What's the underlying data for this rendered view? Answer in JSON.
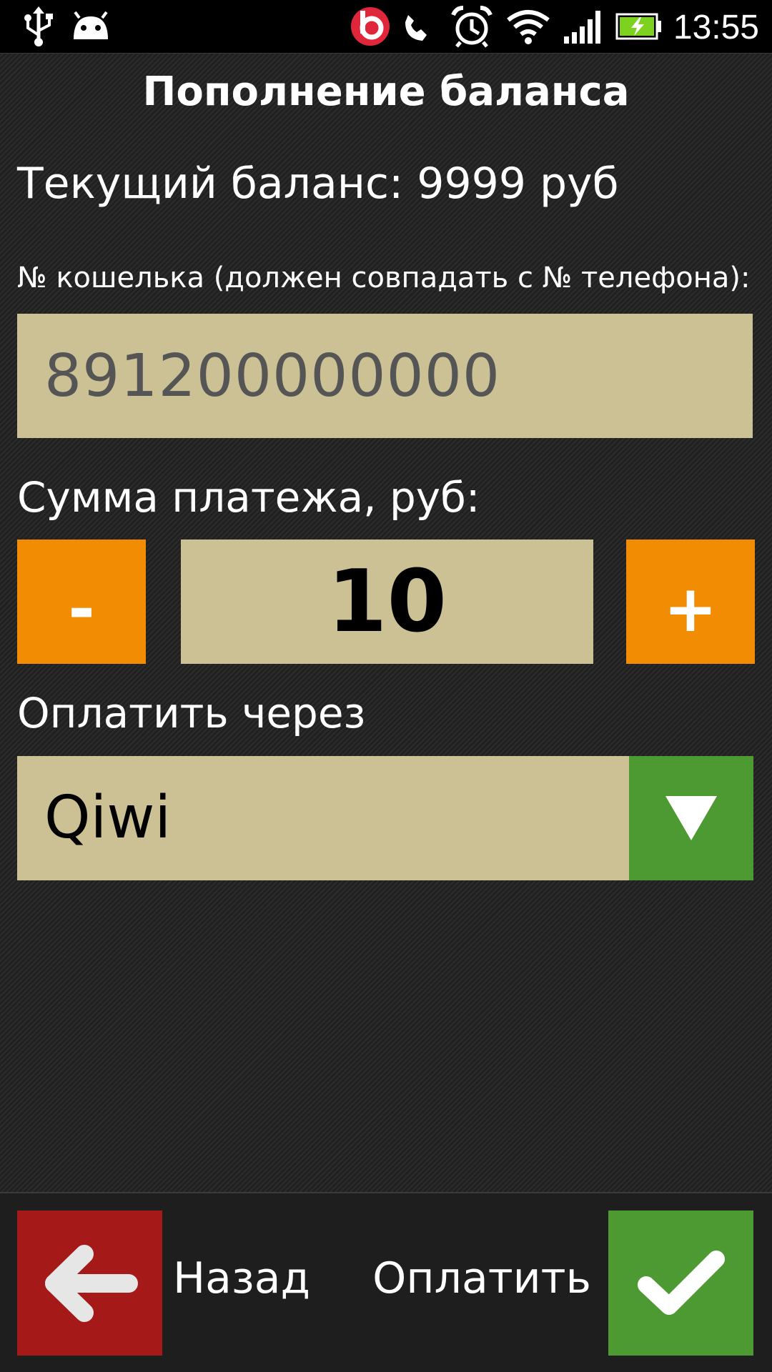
{
  "status_bar": {
    "time": "13:55",
    "icons": [
      "usb-icon",
      "android-icon",
      "beats-audio-icon",
      "phone-signal-icon",
      "alarm-icon",
      "wifi-icon",
      "cellular-signal-icon",
      "battery-charging-icon"
    ]
  },
  "screen": {
    "title": "Пополнение баланса",
    "balance_text": "Текущий баланс: 9999 руб",
    "wallet_label": "№ кошелька (должен совпадать с № телефона):",
    "wallet_value": "891200000000",
    "amount_label": "Сумма платежа, руб:",
    "amount_value": "10",
    "minus_label": "-",
    "plus_label": "+",
    "pay_via_label": "Оплатить через",
    "payment_method": "Qiwi"
  },
  "bottom_bar": {
    "back_label": "Назад",
    "pay_label": "Оплатить"
  },
  "colors": {
    "field_bg": "#cbc194",
    "stepper_orange": "#f28c02",
    "confirm_green": "#4c9a31",
    "back_red": "#a51919",
    "beats_red": "#e0263a",
    "battery_green": "#7dd21f"
  }
}
